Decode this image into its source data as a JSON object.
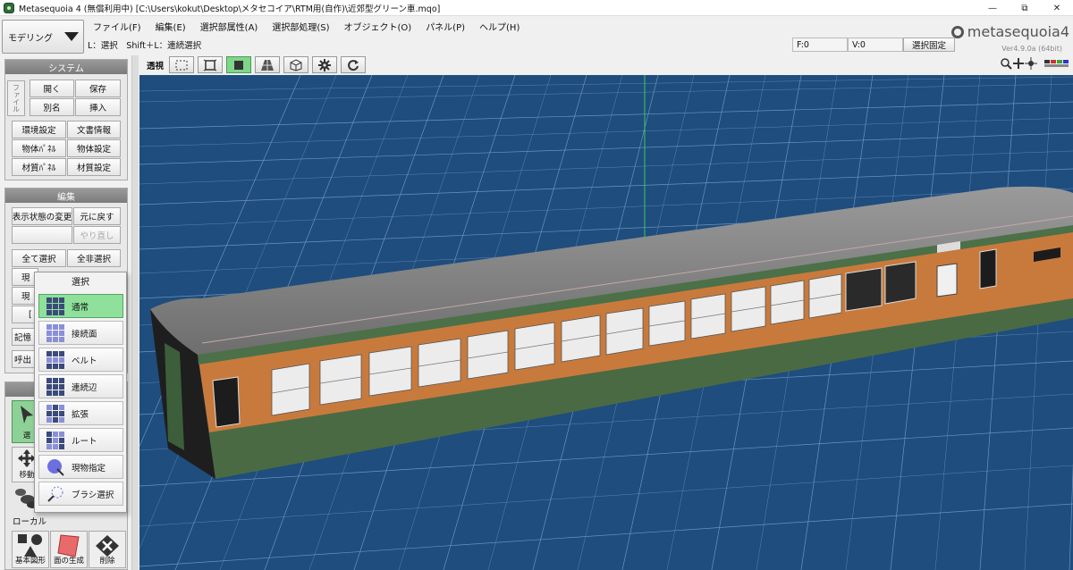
{
  "window": {
    "title": "Metasequoia 4 (無償利用中) [C:\\Users\\kokut\\Desktop\\メタセコイア\\RTM用(自作)\\近郊型グリーン車.mqo]",
    "minimize_glyph": "—",
    "maximize_glyph": "⧉",
    "close_glyph": "✕"
  },
  "mode": {
    "value": "モデリング"
  },
  "menu": [
    "ファイル(F)",
    "編集(E)",
    "選択部属性(A)",
    "選択部処理(S)",
    "オブジェクト(O)",
    "パネル(P)",
    "ヘルプ(H)"
  ],
  "status": {
    "hint": "L：選択　Shift＋L：連続選択",
    "faces": "F:0",
    "vertices": "V:0",
    "lock_label": "選択固定"
  },
  "logo": {
    "text": "metasequoia4",
    "version": "Ver4.9.0a (64bit)"
  },
  "viewport": {
    "projection_label": "透視",
    "background_color": "#1e4d7e",
    "grid_color": "#7fa0c4"
  },
  "system_panel": {
    "title": "システム",
    "file_tag": "ファイル",
    "buttons": [
      "開く",
      "保存",
      "別名",
      "挿入",
      "環境設定",
      "文書情報",
      "物体ﾊﾟﾈﾙ",
      "物体設定",
      "材質ﾊﾟﾈﾙ",
      "材質設定"
    ]
  },
  "edit_panel": {
    "title": "編集",
    "buttons": [
      "表示状態の変更",
      "元に戻す",
      "やり直し",
      "全て選択",
      "全非選択"
    ],
    "hidden_labels": [
      "現",
      "現",
      "[",
      "記憶",
      "呼出"
    ]
  },
  "select_popup": {
    "title": "選択",
    "items": [
      "通常",
      "接続面",
      "ベルト",
      "連続辺",
      "拡張",
      "ルート",
      "現物指定",
      "ブラシ選択"
    ]
  },
  "tools": {
    "select_partial": "選",
    "move_partial": "移動",
    "local_label": "ローカル",
    "bottom": [
      "基本図形",
      "面の生成",
      "削除"
    ]
  },
  "colors": {
    "accent_green": "#7fd68a",
    "train_orange": "#c87a3c",
    "train_green": "#4a6a44",
    "roof_gray": "#8c8c8c"
  }
}
